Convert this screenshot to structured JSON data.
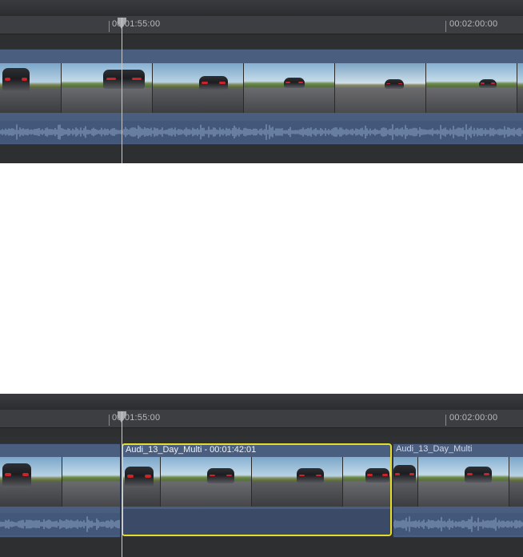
{
  "ruler": {
    "tc_1": "00:01:55:00",
    "tc_2": "00:02:00:00"
  },
  "bottom_clips": {
    "selected_title": "Audi_13_Day_Multi - 00:01:42:01",
    "right_title": "Audi_13_Day_Multi"
  },
  "colors": {
    "selection": "#e6dc2b",
    "clip": "#4a5e80",
    "background": "#303133"
  },
  "icons": {
    "playhead": "playhead-icon"
  }
}
